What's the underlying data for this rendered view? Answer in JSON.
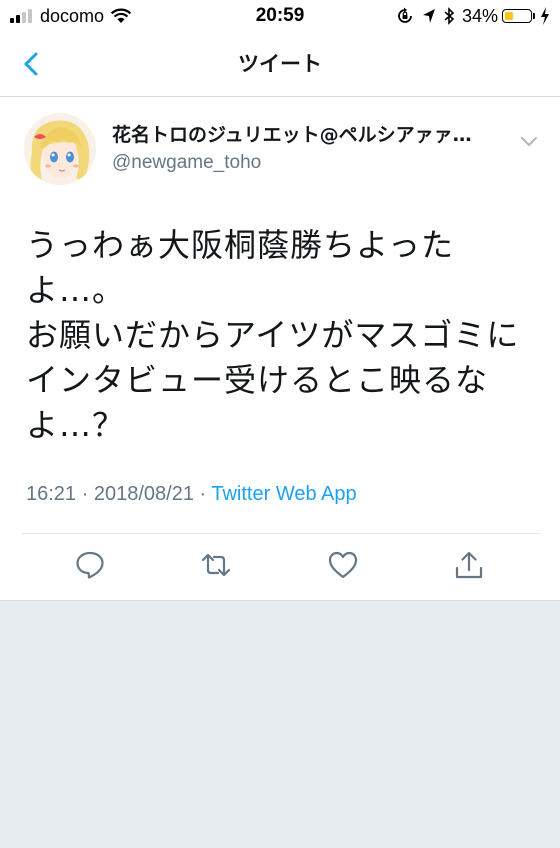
{
  "status_bar": {
    "carrier": "docomo",
    "time": "20:59",
    "battery_percent": "34%",
    "battery_level": 0.34,
    "battery_color": "#f5c518",
    "signal_bars_active": 2,
    "icons": [
      "signal-icon",
      "wifi-icon",
      "orientation-lock-icon",
      "location-icon",
      "bluetooth-icon",
      "battery-icon",
      "charging-icon"
    ]
  },
  "nav": {
    "back_icon": "chevron-left-icon",
    "title": "ツイート",
    "accent": "#1da1f2"
  },
  "tweet": {
    "display_name": "花名トロのジュリエット@ペルシアァァ…",
    "username": "@newgame_toho",
    "text": "うっわぁ大阪桐蔭勝ちよったよ…。\nお願いだからアイツがマスゴミにインタビュー受けるとこ映るなよ…？",
    "time": "16:21",
    "date": "2018/08/21",
    "source": "Twitter Web App",
    "separator": " · "
  },
  "actions": [
    {
      "name": "reply-icon"
    },
    {
      "name": "retweet-icon"
    },
    {
      "name": "like-icon"
    },
    {
      "name": "share-icon"
    }
  ]
}
